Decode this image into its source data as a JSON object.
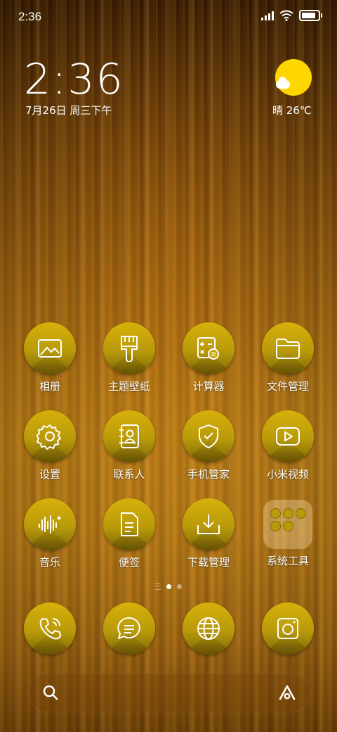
{
  "status_bar": {
    "time": "2:36",
    "battery_level": 0.85
  },
  "clock_widget": {
    "time": "2:36",
    "date": "7月26日 周三下午"
  },
  "weather_widget": {
    "text": "晴 26℃",
    "sun_color": "#ffd600"
  },
  "apps": [
    {
      "label": "相册",
      "icon": "gallery-icon"
    },
    {
      "label": "主题壁纸",
      "icon": "paintbrush-icon"
    },
    {
      "label": "计算器",
      "icon": "calculator-icon"
    },
    {
      "label": "文件管理",
      "icon": "folder-icon"
    },
    {
      "label": "设置",
      "icon": "gear-icon"
    },
    {
      "label": "联系人",
      "icon": "contacts-icon"
    },
    {
      "label": "手机管家",
      "icon": "shield-check-icon"
    },
    {
      "label": "小米视频",
      "icon": "video-play-icon"
    },
    {
      "label": "音乐",
      "icon": "music-wave-icon"
    },
    {
      "label": "便签",
      "icon": "notes-icon"
    },
    {
      "label": "下载管理",
      "icon": "download-icon"
    },
    {
      "label": "系统工具",
      "icon": "folder-group-icon"
    }
  ],
  "dock": [
    {
      "icon": "phone-icon"
    },
    {
      "icon": "message-icon"
    },
    {
      "icon": "browser-globe-icon"
    },
    {
      "icon": "camera-icon"
    }
  ],
  "pagination": {
    "active": 1,
    "total": 2
  },
  "search_bar": {
    "left_icon": "search-icon",
    "right_icon": "assistant-a-icon"
  },
  "theme": {
    "icon_gold": "#c8a40a"
  }
}
